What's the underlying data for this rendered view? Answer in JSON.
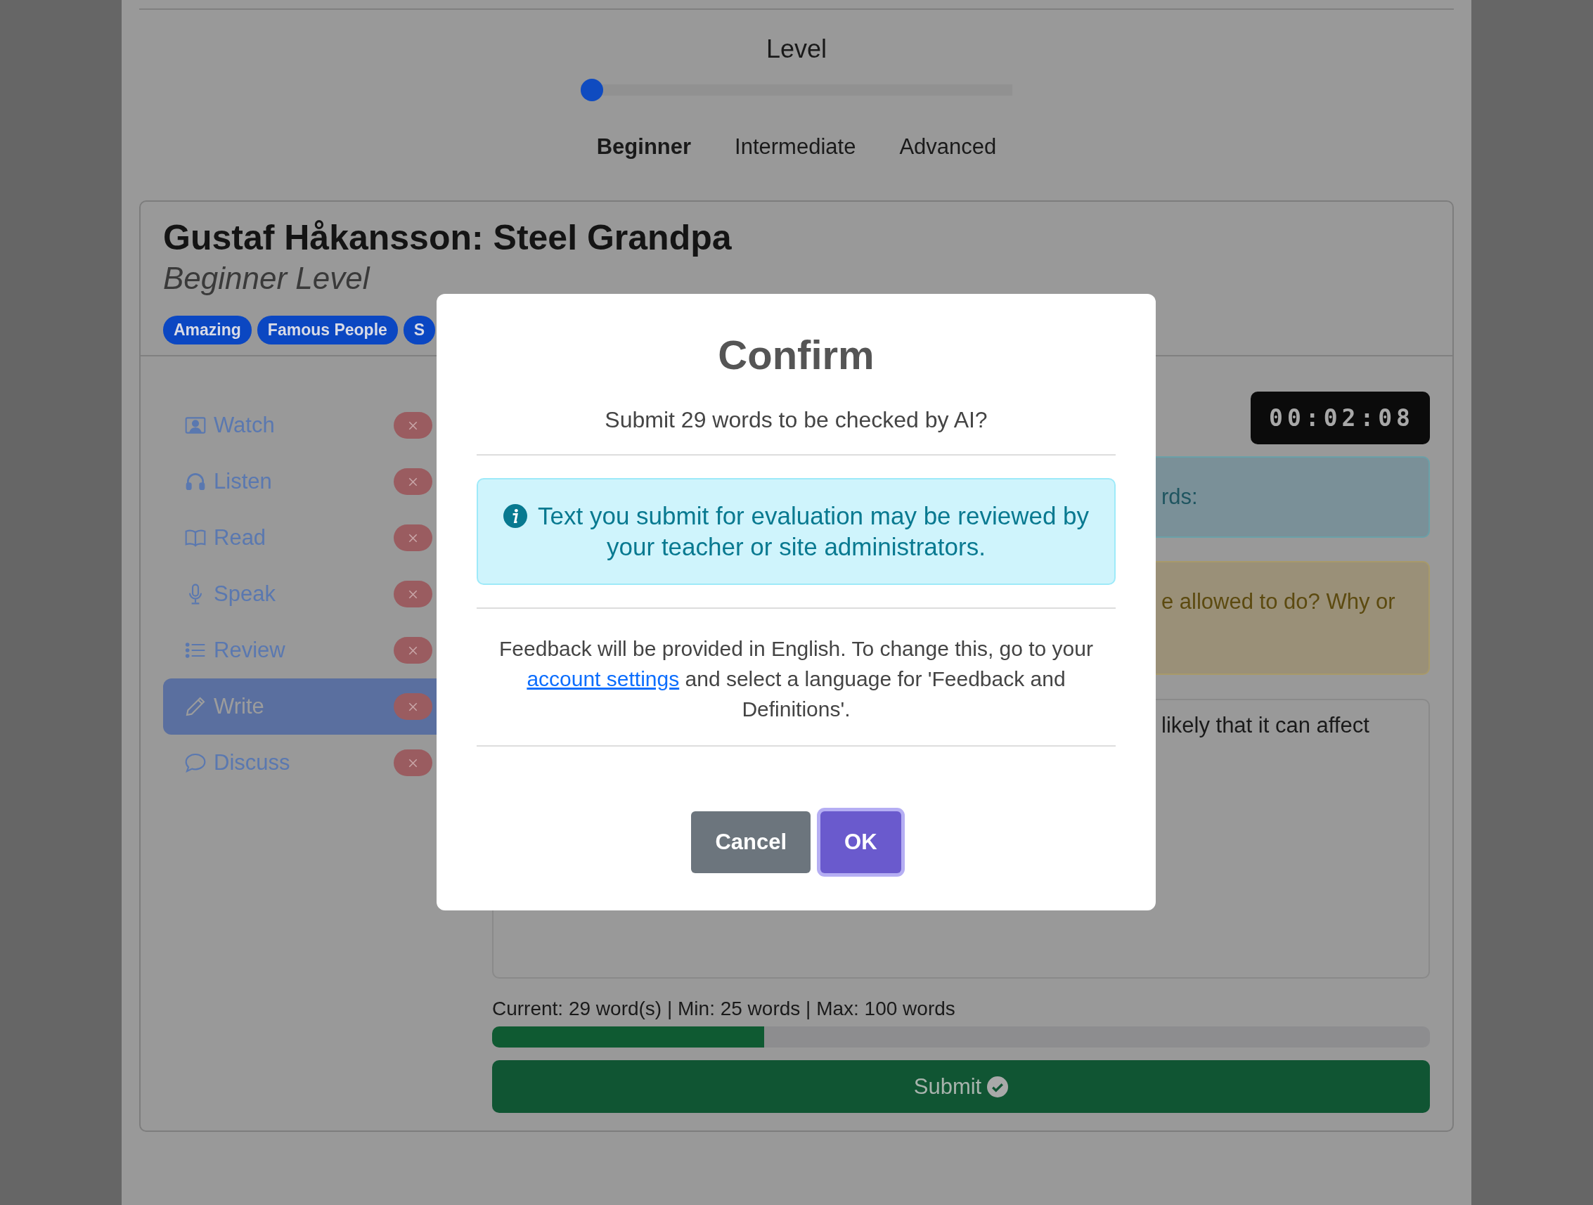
{
  "level_selector": {
    "title": "Level",
    "level": 0,
    "options": [
      {
        "label": "Beginner",
        "selected": true
      },
      {
        "label": "Intermediate",
        "selected": false
      },
      {
        "label": "Advanced",
        "selected": false
      }
    ]
  },
  "lesson": {
    "title": "Gustaf Håkansson: Steel Grandpa",
    "subtitle": "Beginner Level",
    "tags": [
      "Amazing",
      "Famous People",
      "S"
    ]
  },
  "sidebar": {
    "items": [
      {
        "label": "Watch",
        "selected": false
      },
      {
        "label": "Listen",
        "selected": false
      },
      {
        "label": "Read",
        "selected": false
      },
      {
        "label": "Speak",
        "selected": false
      },
      {
        "label": "Review",
        "selected": false
      },
      {
        "label": "Write",
        "selected": true
      },
      {
        "label": "Discuss",
        "selected": false
      }
    ]
  },
  "timer": "00:02:08",
  "info_box": {
    "text": "rds:"
  },
  "prompt_box": {
    "text": "e allowed to do? Why or"
  },
  "answer": {
    "value": "likely that it can affect"
  },
  "word_count": "Current: 29 word(s) | Min: 25 words | Max: 100 words",
  "progress": {
    "level": 0.29
  },
  "submit_button": "Submit",
  "dialog": {
    "title": "Confirm",
    "message": "Submit 29 words to be checked by AI?",
    "notice": "Text you submit for evaluation may be reviewed by your teacher or site administrators.",
    "feedback_before": "Feedback will be provided in English. To change this, go to your",
    "feedback_link": "account settings",
    "feedback_after": "and select a language for 'Feedback and Definitions'.",
    "buttons": [
      {
        "label": "Cancel",
        "kind": "secondary",
        "focused": false
      },
      {
        "label": "OK",
        "kind": "primary",
        "focused": true
      }
    ]
  }
}
